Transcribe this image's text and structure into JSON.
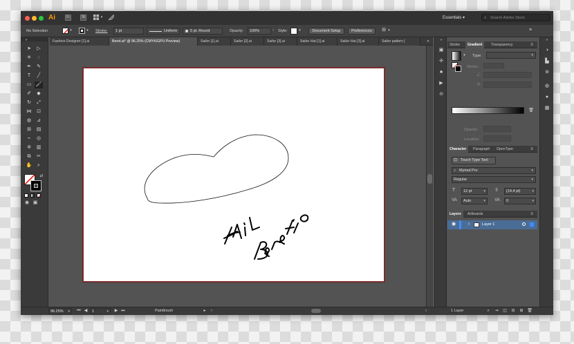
{
  "title_bar": {
    "app_badge": "Ai",
    "workspace": "Essentials",
    "search_placeholder": "Search Adobe Stock"
  },
  "options_bar": {
    "selection": "No Selection",
    "stroke_label": "Stroke:",
    "stroke_weight": "1 pt",
    "profile": "Uniform",
    "brush": "5 pt. Round",
    "opacity_label": "Opacity:",
    "opacity_value": "100%",
    "style_label": "Style:",
    "doc_setup": "Document Setup",
    "preferences": "Preferences"
  },
  "doc_tabs": [
    "Fashion Designer [1].ai",
    "Beret.ai* @ 96.25% (CMYK/GPU Preview)",
    "Sailor [1].ai",
    "Sailor [2].ai",
    "Sailor [3].ai",
    "Sailor Hat [1].ai",
    "Sailor Hat [3].ai",
    "Sailor pattern ["
  ],
  "canvas": {
    "handwriting_1": "FAIL",
    "handwriting_2": "Beret io"
  },
  "gradient_panel": {
    "tabs": [
      "Stroke",
      "Gradient",
      "Transparency"
    ],
    "type_label": "Type:",
    "stroke_label": "Stroke:",
    "opacity_label": "Opacity:",
    "location_label": "Location:"
  },
  "character_panel": {
    "tabs": [
      "Character",
      "Paragraph",
      "OpenType"
    ],
    "touch_type": "Touch Type Tool",
    "font_search": "Myriad Pro",
    "font_style": "Regular",
    "font_size": "12 pt",
    "leading": "(14.4 pt)",
    "kerning": "Auto",
    "tracking": "0"
  },
  "layers_panel": {
    "tabs": [
      "Layers",
      "Artboards"
    ],
    "layer_name": "Layer 1",
    "footer_count": "1 Layer"
  },
  "status_bar": {
    "zoom": "96.25%",
    "artboard": "1",
    "tool": "Paintbrush"
  },
  "colors": {
    "window": "#535353",
    "chrome": "#3a3a3a",
    "artboard_border": "#8a2c2c",
    "layer_highlight": "#4a6d96",
    "traffic_red": "#ff5f57",
    "traffic_yellow": "#febc2e",
    "traffic_green": "#28c840",
    "ai_orange": "#ff9a00"
  }
}
